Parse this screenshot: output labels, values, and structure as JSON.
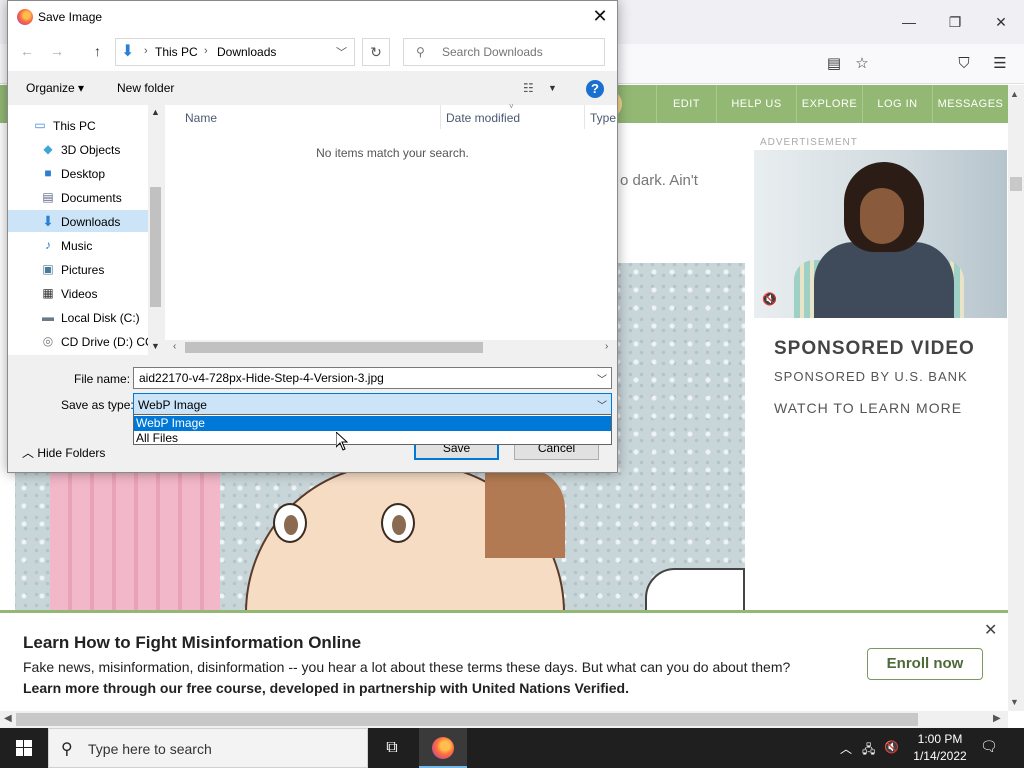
{
  "browser": {
    "site_nav": [
      "EDIT",
      "HELP US",
      "EXPLORE",
      "LOG IN",
      "MESSAGES"
    ],
    "article_snippet": "o dark. Ain't",
    "ad": {
      "label": "ADVERTISEMENT",
      "title": "SPONSORED VIDEO",
      "sponsor": "SPONSORED BY U.S. BANK",
      "cta": "WATCH TO LEARN MORE"
    },
    "banner": {
      "title": "Learn How to Fight Misinformation Online",
      "text": "Fake news, misinformation, disinformation -- you hear a lot about these terms these days. But what can you do about them?",
      "text_bold": "Learn more through our free course, developed in partnership with United Nations Verified.",
      "button": "Enroll now",
      "close": "✕"
    }
  },
  "dialog": {
    "title": "Save Image",
    "close": "✕",
    "breadcrumb": [
      "This PC",
      "Downloads"
    ],
    "search_placeholder": "Search Downloads",
    "toolbar": {
      "organize": "Organize ▾",
      "new_folder": "New folder"
    },
    "nav_items": [
      {
        "label": "This PC",
        "icon": "pc-icon"
      },
      {
        "label": "3D Objects",
        "icon": "cube-icon"
      },
      {
        "label": "Desktop",
        "icon": "desktop-icon"
      },
      {
        "label": "Documents",
        "icon": "documents-icon"
      },
      {
        "label": "Downloads",
        "icon": "download-icon",
        "selected": true
      },
      {
        "label": "Music",
        "icon": "music-icon"
      },
      {
        "label": "Pictures",
        "icon": "pictures-icon"
      },
      {
        "label": "Videos",
        "icon": "videos-icon"
      },
      {
        "label": "Local Disk (C:)",
        "icon": "disk-icon"
      },
      {
        "label": "CD Drive (D:) CC",
        "icon": "cd-icon"
      }
    ],
    "columns": [
      "Name",
      "Date modified",
      "Type"
    ],
    "empty_message": "No items match your search.",
    "file_name_label": "File name:",
    "file_name_value": "aid22170-v4-728px-Hide-Step-4-Version-3.jpg",
    "save_type_label": "Save as type:",
    "save_type_value": "WebP Image",
    "type_options": [
      "WebP Image",
      "All Files"
    ],
    "hide_folders": "Hide Folders",
    "save": "Save",
    "cancel": "Cancel"
  },
  "taskbar": {
    "search_placeholder": "Type here to search",
    "time": "1:00 PM",
    "date": "1/14/2022"
  },
  "colors": {
    "site_green": "#93b874",
    "selection_blue": "#0078d7",
    "selection_light": "#cce4f7"
  }
}
